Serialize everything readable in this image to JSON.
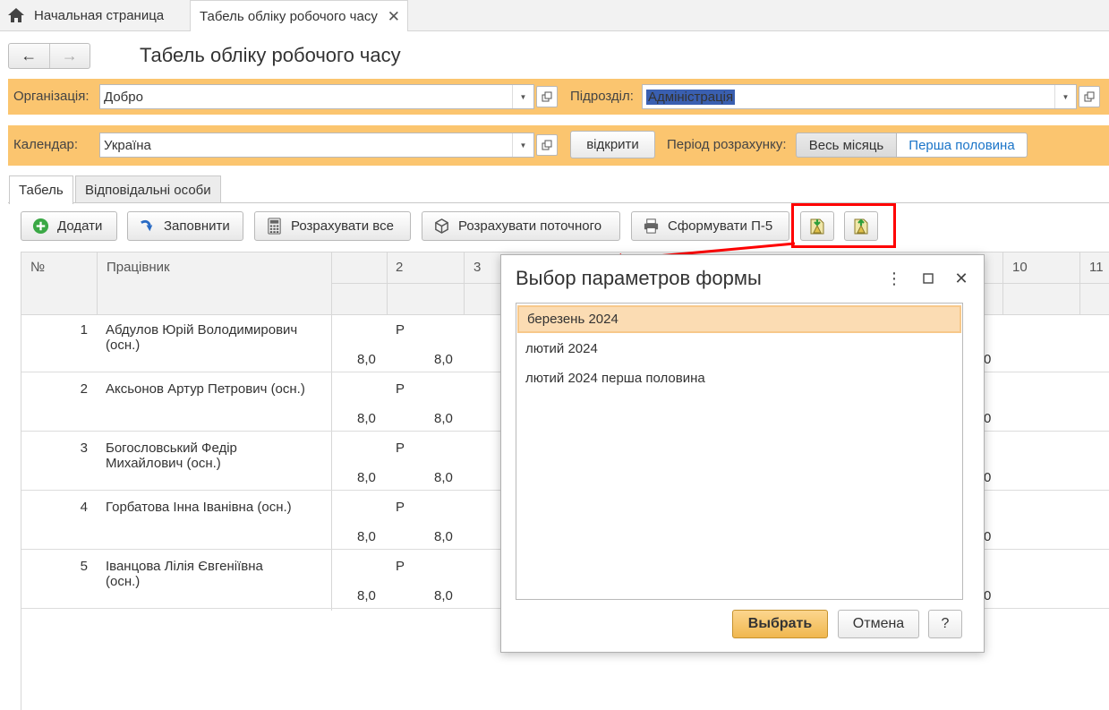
{
  "tabs": {
    "home_label": "Начальная страница",
    "active_label": "Табель обліку робочого часу",
    "close_glyph": "✕"
  },
  "header": {
    "back_glyph": "←",
    "forward_glyph": "→",
    "title": "Табель обліку робочого часу"
  },
  "organization": {
    "label": "Організація:",
    "value": "Добро"
  },
  "department": {
    "label": "Підрозділ:",
    "value": "Адміністрація"
  },
  "calendar": {
    "label": "Календар:",
    "value": "Україна",
    "open_button": "відкрити"
  },
  "period": {
    "label": "Період розрахунку:",
    "whole_month": "Весь місяць",
    "first_half": "Перша половина"
  },
  "form_tabs": {
    "timesheet": "Табель",
    "responsible": "Відповідальні особи"
  },
  "toolbar": {
    "add": "Додати",
    "fill": "Заповнити",
    "calc_all": "Розрахувати все",
    "calc_current": "Розрахувати поточного",
    "form_p5": "Сформувати П-5"
  },
  "table": {
    "col_num": "№",
    "col_employee": "Працівник",
    "day_headers": {
      "d2": "2",
      "d3": "3",
      "d10": "10",
      "d11": "11"
    },
    "rows": [
      {
        "num": "1",
        "name": "Абдулов Юрій Володимирович (осн.)",
        "code": "Р",
        "h1": "8,0",
        "h2": "8,0",
        "right": "0"
      },
      {
        "num": "2",
        "name": "Аксьонов Артур Петрович (осн.)",
        "code": "Р",
        "h1": "8,0",
        "h2": "8,0",
        "right": "0"
      },
      {
        "num": "3",
        "name": "Богословський Федір Михайлович (осн.)",
        "code": "Р",
        "h1": "8,0",
        "h2": "8,0",
        "right": "0"
      },
      {
        "num": "4",
        "name": "Горбатова Інна Іванівна (осн.)",
        "code": "Р",
        "h1": "8,0",
        "h2": "8,0",
        "right": "0"
      },
      {
        "num": "5",
        "name": "Іванцова Лілія Євгеніївна (осн.)",
        "code": "Р",
        "h1": "8,0",
        "h2": "8,0",
        "right": "0"
      }
    ]
  },
  "dialog": {
    "title": "Выбор параметров формы",
    "items": [
      "березень 2024",
      "лютий 2024",
      "лютий 2024 перша половина"
    ],
    "ok": "Выбрать",
    "cancel": "Отмена",
    "help": "?",
    "more_glyph": "⋮",
    "close_glyph": "✕"
  },
  "colors": {
    "panel": "#fbc56f",
    "accent_blue": "#1a74c8",
    "annotation_red": "#ff0000"
  }
}
